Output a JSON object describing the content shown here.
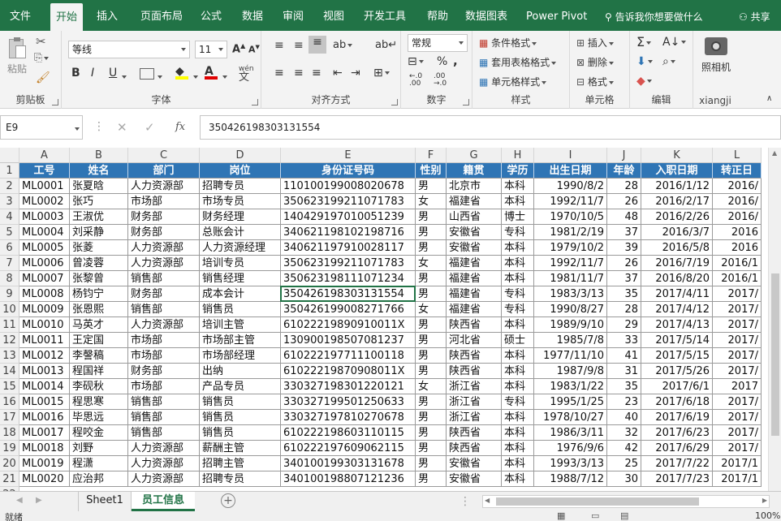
{
  "tabs": [
    "文件",
    "开始",
    "插入",
    "页面布局",
    "公式",
    "数据",
    "审阅",
    "视图",
    "开发工具",
    "帮助",
    "数据图表",
    "Power Pivot"
  ],
  "active_tab": "开始",
  "tell_me": "告诉我你想要做什么",
  "share": "共享",
  "ribbon": {
    "clipboard": {
      "label": "剪贴板",
      "paste": "粘贴"
    },
    "font": {
      "label": "字体",
      "name": "等线",
      "size": "11",
      "bold": "B",
      "italic": "I",
      "underline": "U",
      "wen": "wén"
    },
    "alignment": {
      "label": "对齐方式"
    },
    "number": {
      "label": "数字",
      "format": "常规",
      "percent": "%",
      "comma": ","
    },
    "styles": {
      "label": "样式",
      "conditional": "条件格式",
      "table": "套用表格格式",
      "cell": "单元格样式"
    },
    "cells": {
      "label": "单元格",
      "insert": "插入",
      "delete": "删除",
      "format": "格式"
    },
    "editing": {
      "label": "编辑"
    },
    "xiangji": {
      "label": "xiangji",
      "camera": "照相机"
    }
  },
  "formula_bar": {
    "name_box": "E9",
    "fx": "fx",
    "content": "350426198303131554"
  },
  "columns": [
    "A",
    "B",
    "C",
    "D",
    "E",
    "F",
    "G",
    "H",
    "I",
    "J",
    "K",
    "L"
  ],
  "header_row": [
    "工号",
    "姓名",
    "部门",
    "岗位",
    "身份证号码",
    "性别",
    "籍贯",
    "学历",
    "出生日期",
    "年龄",
    "入职日期",
    "转正日"
  ],
  "rows": [
    [
      "ML0001",
      "张夏晗",
      "人力资源部",
      "招聘专员",
      "110100199008020678",
      "男",
      "北京市",
      "本科",
      "1990/8/2",
      "28",
      "2016/1/12",
      "2016/"
    ],
    [
      "ML0002",
      "张巧",
      "市场部",
      "市场专员",
      "350623199211071783",
      "女",
      "福建省",
      "本科",
      "1992/11/7",
      "26",
      "2016/2/17",
      "2016/"
    ],
    [
      "ML0003",
      "王淑优",
      "财务部",
      "财务经理",
      "140429197010051239",
      "男",
      "山西省",
      "博士",
      "1970/10/5",
      "48",
      "2016/2/26",
      "2016/"
    ],
    [
      "ML0004",
      "刘采静",
      "财务部",
      "总账会计",
      "340621198102198716",
      "男",
      "安徽省",
      "专科",
      "1981/2/19",
      "37",
      "2016/3/7",
      "2016"
    ],
    [
      "ML0005",
      "张菱",
      "人力资源部",
      "人力资源经理",
      "340621197910028117",
      "男",
      "安徽省",
      "本科",
      "1979/10/2",
      "39",
      "2016/5/8",
      "2016"
    ],
    [
      "ML0006",
      "曾凌蓉",
      "人力资源部",
      "培训专员",
      "350623199211071783",
      "女",
      "福建省",
      "本科",
      "1992/11/7",
      "26",
      "2016/7/19",
      "2016/1"
    ],
    [
      "ML0007",
      "张黎曾",
      "销售部",
      "销售经理",
      "350623198111071234",
      "男",
      "福建省",
      "本科",
      "1981/11/7",
      "37",
      "2016/8/20",
      "2016/1"
    ],
    [
      "ML0008",
      "杨钧宁",
      "财务部",
      "成本会计",
      "350426198303131554",
      "男",
      "福建省",
      "专科",
      "1983/3/13",
      "35",
      "2017/4/11",
      "2017/"
    ],
    [
      "ML0009",
      "张恩熙",
      "销售部",
      "销售员",
      "350426199008271766",
      "女",
      "福建省",
      "专科",
      "1990/8/27",
      "28",
      "2017/4/12",
      "2017/"
    ],
    [
      "ML0010",
      "马英才",
      "人力资源部",
      "培训主管",
      "61022219890910011X",
      "男",
      "陕西省",
      "本科",
      "1989/9/10",
      "29",
      "2017/4/13",
      "2017/"
    ],
    [
      "ML0011",
      "王定国",
      "市场部",
      "市场部主管",
      "130900198507081237",
      "男",
      "河北省",
      "硕士",
      "1985/7/8",
      "33",
      "2017/5/14",
      "2017/"
    ],
    [
      "ML0012",
      "李謦稿",
      "市场部",
      "市场部经理",
      "610222197711100118",
      "男",
      "陕西省",
      "本科",
      "1977/11/10",
      "41",
      "2017/5/15",
      "2017/"
    ],
    [
      "ML0013",
      "程国祥",
      "财务部",
      "出纳",
      "61022219870908011X",
      "男",
      "陕西省",
      "本科",
      "1987/9/8",
      "31",
      "2017/5/26",
      "2017/"
    ],
    [
      "ML0014",
      "李砚秋",
      "市场部",
      "产品专员",
      "330327198301220121",
      "女",
      "浙江省",
      "本科",
      "1983/1/22",
      "35",
      "2017/6/1",
      "2017"
    ],
    [
      "ML0015",
      "程思寒",
      "销售部",
      "销售员",
      "330327199501250633",
      "男",
      "浙江省",
      "专科",
      "1995/1/25",
      "23",
      "2017/6/18",
      "2017/"
    ],
    [
      "ML0016",
      "毕思远",
      "销售部",
      "销售员",
      "330327197810270678",
      "男",
      "浙江省",
      "本科",
      "1978/10/27",
      "40",
      "2017/6/19",
      "2017/"
    ],
    [
      "ML0017",
      "程咬金",
      "销售部",
      "销售员",
      "610222198603110115",
      "男",
      "陕西省",
      "本科",
      "1986/3/11",
      "32",
      "2017/6/23",
      "2017/"
    ],
    [
      "ML0018",
      "刘野",
      "人力资源部",
      "薪酬主管",
      "610222197609062115",
      "男",
      "陕西省",
      "本科",
      "1976/9/6",
      "42",
      "2017/6/29",
      "2017/"
    ],
    [
      "ML0019",
      "程潇",
      "人力资源部",
      "招聘主管",
      "340100199303131678",
      "男",
      "安徽省",
      "本科",
      "1993/3/13",
      "25",
      "2017/7/22",
      "2017/1"
    ],
    [
      "ML0020",
      "应治邦",
      "人力资源部",
      "招聘专员",
      "340100198807121236",
      "男",
      "安徽省",
      "本科",
      "1988/7/12",
      "30",
      "2017/7/23",
      "2017/1"
    ]
  ],
  "sheets": [
    "Sheet1",
    "员工信息"
  ],
  "active_sheet": "员工信息",
  "status": {
    "ready": "就绪",
    "zoom": "100%"
  }
}
